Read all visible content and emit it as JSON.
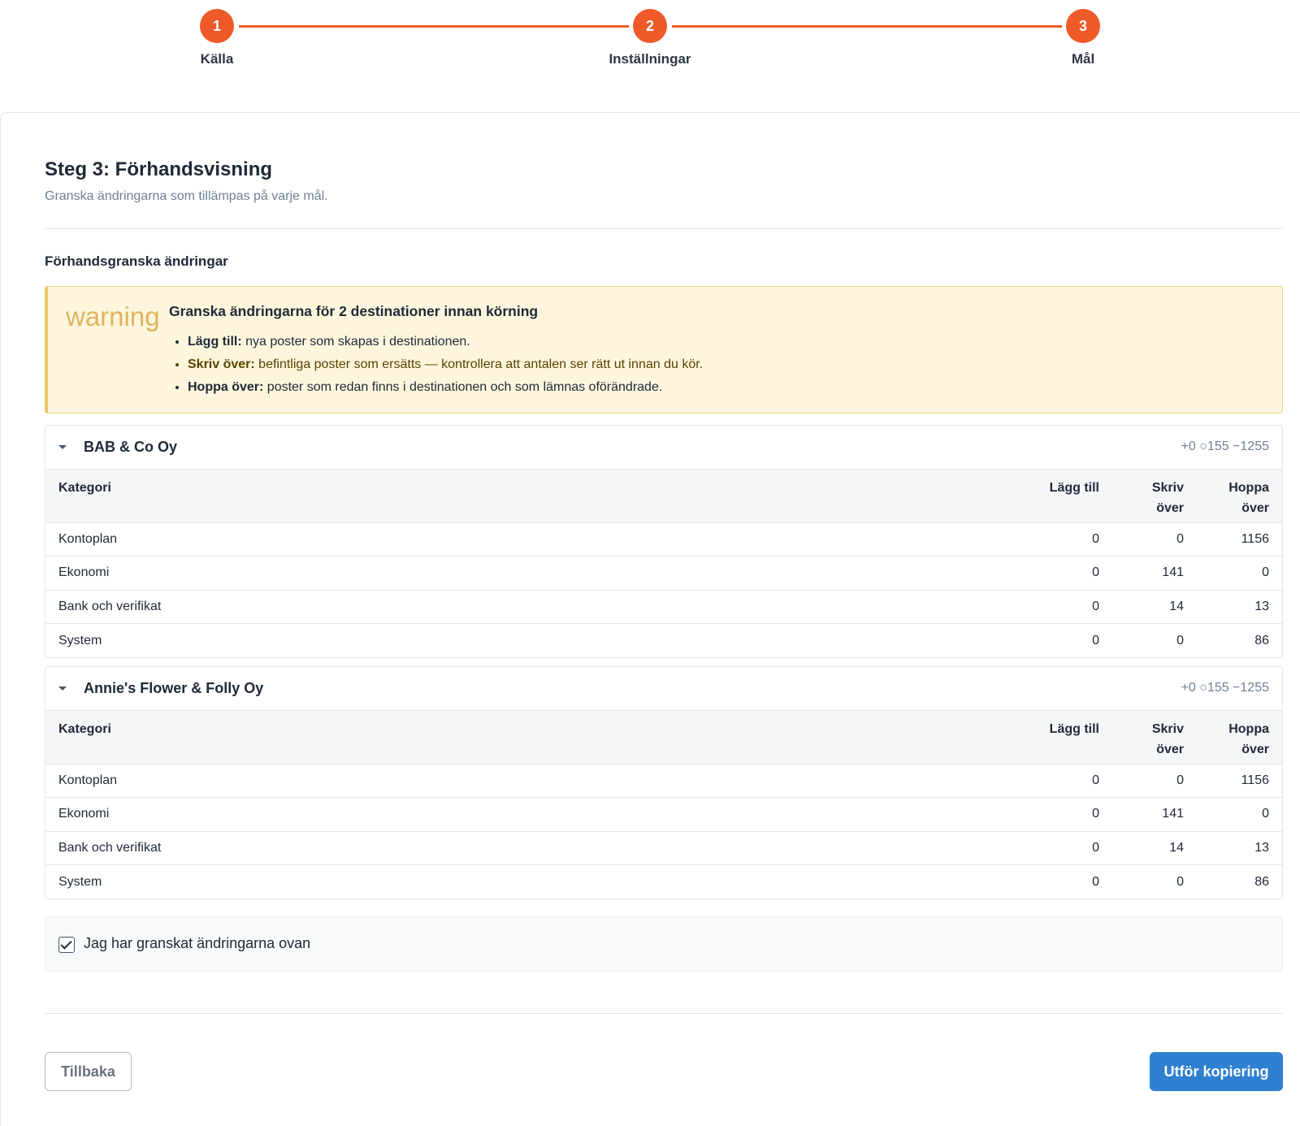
{
  "stepper": {
    "steps": [
      {
        "number": "1",
        "label": "Källa"
      },
      {
        "number": "2",
        "label": "Inställningar"
      },
      {
        "number": "3",
        "label": "Mål"
      }
    ]
  },
  "header": {
    "title": "Steg 3: Förhandsvisning",
    "subtitle": "Granska ändringarna som tillämpas på varje mål."
  },
  "preview": {
    "section_title": "Förhandsgranska ändringar"
  },
  "warning": {
    "icon_text": "warning",
    "title": "Granska ändringarna för 2 destinationer innan körning",
    "items": [
      {
        "term": "Lägg till:",
        "text": " nya poster som skapas i destinationen."
      },
      {
        "term": "Skriv över:",
        "text": " befintliga poster som ersätts — kontrollera att antalen ser rätt ut innan du kör."
      },
      {
        "term": "Hoppa över:",
        "text": " poster som redan finns i destinationen och som lämnas oförändrade."
      }
    ]
  },
  "table_headers": {
    "category": "Kategori",
    "add": "Lägg till",
    "overwrite_line1": "Skriv",
    "overwrite_line2": "över",
    "skip_line1": "Hoppa",
    "skip_line2": "över"
  },
  "destinations": [
    {
      "name": "BAB & Co Oy",
      "summary": "+0 ○155 −1255",
      "rows": [
        {
          "category": "Kontoplan",
          "add": "0",
          "overwrite": "0",
          "skip": "1156"
        },
        {
          "category": "Ekonomi",
          "add": "0",
          "overwrite": "141",
          "skip": "0"
        },
        {
          "category": "Bank och verifikat",
          "add": "0",
          "overwrite": "14",
          "skip": "13"
        },
        {
          "category": "System",
          "add": "0",
          "overwrite": "0",
          "skip": "86"
        }
      ]
    },
    {
      "name": "Annie's Flower & Folly Oy",
      "summary": "+0 ○155 −1255",
      "rows": [
        {
          "category": "Kontoplan",
          "add": "0",
          "overwrite": "0",
          "skip": "1156"
        },
        {
          "category": "Ekonomi",
          "add": "0",
          "overwrite": "141",
          "skip": "0"
        },
        {
          "category": "Bank och verifikat",
          "add": "0",
          "overwrite": "14",
          "skip": "13"
        },
        {
          "category": "System",
          "add": "0",
          "overwrite": "0",
          "skip": "86"
        }
      ]
    }
  ],
  "confirm": {
    "label": "Jag har granskat ändringarna ovan",
    "checked": true
  },
  "footer": {
    "back_label": "Tillbaka",
    "run_label": "Utför kopiering"
  },
  "colors": {
    "accent": "#ef5a28",
    "primary_button": "#2f80d1",
    "warning_bg": "#fdf6dd",
    "warning_border": "#e9c46a"
  }
}
